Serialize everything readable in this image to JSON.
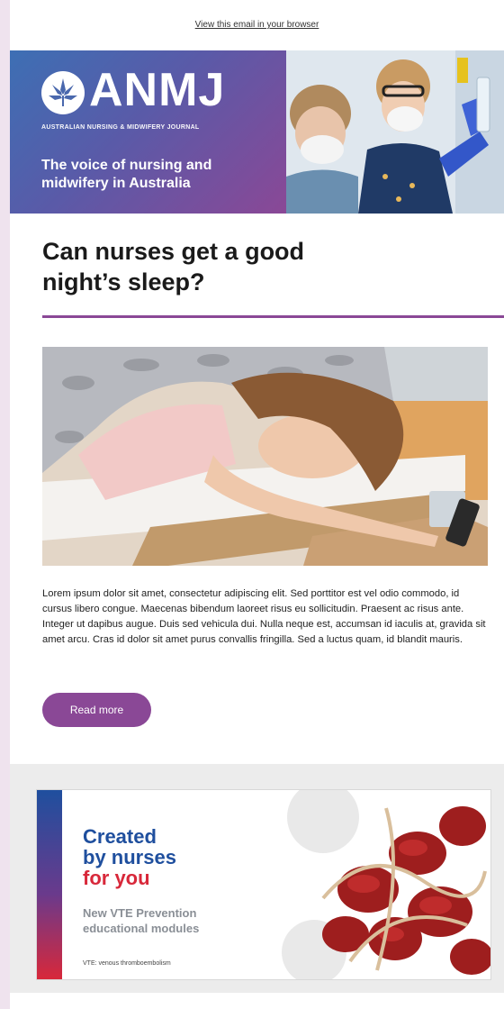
{
  "header": {
    "browser_link": "View this email in your browser"
  },
  "brand": {
    "logo_text": "ANMJ",
    "logo_subtitle": "AUSTRALIAN NURSING & MIDWIFERY JOURNAL",
    "tagline": "The voice of nursing and midwifery in Australia",
    "color_brand_purple": "#8a4896",
    "color_brand_blue": "#3d6fb4"
  },
  "article": {
    "headline": "Can nurses get a good night’s sleep?",
    "body": "Lorem ipsum dolor sit amet, consectetur adipiscing elit. Sed porttitor est vel odio commodo, id cursus libero congue. Maecenas bibendum laoreet risus eu sollicitudin. Praesent ac risus ante. Integer ut dapibus augue. Duis sed vehicula dui. Nulla neque est, accumsan id iaculis at, gravida sit amet arcu. Cras id dolor sit amet purus convallis fringilla. Sed a luctus quam, id blandit mauris.",
    "read_more_label": "Read more"
  },
  "ad": {
    "line1": "Created",
    "line2": "by nurses",
    "line3": "for you",
    "subtitle": "New VTE Prevention educational modules",
    "footnote": "VTE: venous thromboembolism"
  }
}
